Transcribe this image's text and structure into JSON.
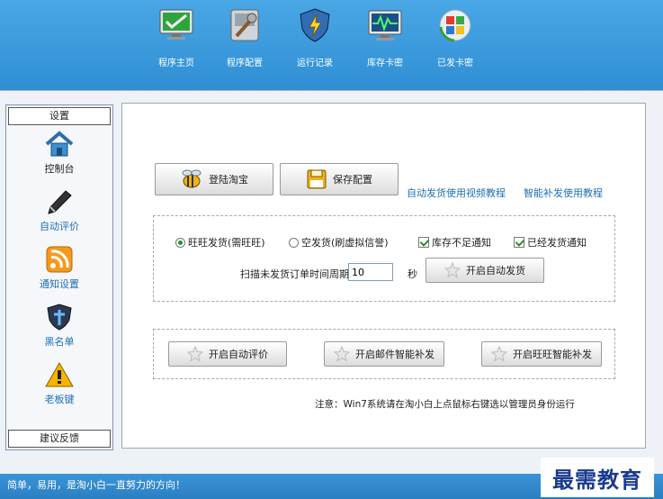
{
  "toolbar": {
    "items": [
      {
        "label": "程序主页",
        "icon": "monitor-icon"
      },
      {
        "label": "程序配置",
        "icon": "tools-icon"
      },
      {
        "label": "运行记录",
        "icon": "shield-icon"
      },
      {
        "label": "库存卡密",
        "icon": "pulse-monitor-icon"
      },
      {
        "label": "已发卡密",
        "icon": "windows-refresh-icon"
      }
    ]
  },
  "sidebar": {
    "header": "设置",
    "items": [
      {
        "label": "控制台",
        "icon": "home-icon"
      },
      {
        "label": "自动评价",
        "icon": "pen-icon"
      },
      {
        "label": "通知设置",
        "icon": "rss-icon"
      },
      {
        "label": "黑名单",
        "icon": "shield-cross-icon"
      },
      {
        "label": "老板键",
        "icon": "warning-icon"
      }
    ],
    "footer": "建议反馈"
  },
  "main": {
    "login_button": "登陆淘宝",
    "save_button": "保存配置",
    "links": [
      "自动发货使用视频教程",
      "智能补发使用教程"
    ],
    "options": {
      "radio_wangwang": "旺旺发货(需旺旺)",
      "radio_empty": "空发货(刷虚拟信誉)",
      "check_stock": "库存不足通知",
      "check_sent": "已经发货通知"
    },
    "scan": {
      "label": "扫描未发货订单时间周期：",
      "value": "10",
      "unit": "秒",
      "button": "开启自动发货"
    },
    "actions": [
      "开启自动评价",
      "开启邮件智能补发",
      "开启旺旺智能补发"
    ],
    "note": "注意：Win7系统请在淘小白上点鼠标右键选以管理员身份运行"
  },
  "statusbar": {
    "text": "简单，易用，是淘小白一直努力的方向！"
  },
  "watermark": "最需教育",
  "colors": {
    "accent": "#2f87c7",
    "link": "#1e6fb3",
    "check": "#2e8b2e"
  }
}
